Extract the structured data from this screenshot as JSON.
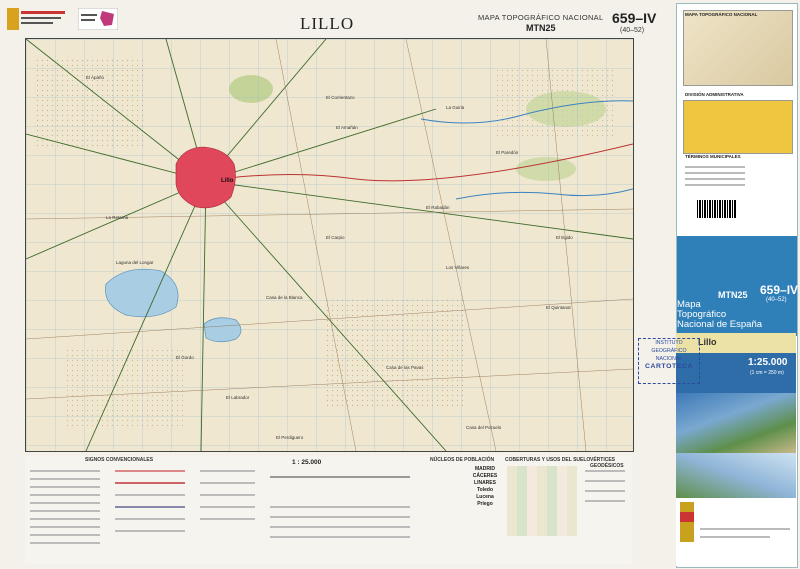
{
  "header": {
    "title": "LILLO",
    "subtitle": "MAPA TOPOGRÁFICO NACIONAL",
    "series": "MTN25",
    "sheet": "659–IV",
    "sheet_code": "(40–52)"
  },
  "map": {
    "town_label": "Lillo",
    "labels": [
      "El Apaño",
      "El Corrientazo",
      "La Guirla",
      "El Paredón",
      "El Carpio",
      "Los Villares",
      "Laguna del Longar",
      "El Quintanar",
      "Casa de las Pavas",
      "El Labrador",
      "Casa del Pozuelo",
      "El Amañán",
      "Casa de la Blanca",
      "El Egido",
      "El Gordo",
      "La Retama",
      "El Rabadán",
      "El Perdiguero"
    ],
    "colors": {
      "terrain": "#efe7cf",
      "town": "#e0475b",
      "lake": "#a9cde2",
      "roads": "#3d6a2c",
      "rivers": "#3b82c2"
    }
  },
  "legend": {
    "signos_title": "SIGNOS CONVENCIONALES",
    "scale_title": "1 : 25.000",
    "nucleos_title": "NÚCLEOS DE POBLACIÓN",
    "cobertura_title": "COBERTURAS Y USOS DEL SUELO",
    "vertices_title": "VÉRTICES GEODÉSICOS",
    "cities": [
      "MADRID",
      "CÁCERES",
      "LINARES",
      "Toledo",
      "Lucena",
      "Priego"
    ]
  },
  "panel": {
    "top_title": "MAPA TOPOGRÁFICO NACIONAL",
    "admin_title": "DIVISIÓN ADMINISTRATIVA",
    "municipal_title": "TÉRMINOS MUNICIPALES",
    "series": "MTN25",
    "sheet": "659–IV",
    "sheet_code": "(40–52)",
    "big_title_1": "Mapa",
    "big_title_2": "Topográfico",
    "big_title_3": "Nacional de España",
    "name": "Lillo",
    "scale": "1:25.000",
    "scale_sub": "(1 cm = 250 m)"
  },
  "stamp": {
    "l1": "INSTITUTO GEOGRÁFICO",
    "l2": "NACIONAL",
    "l3": "CARTOTECA"
  }
}
